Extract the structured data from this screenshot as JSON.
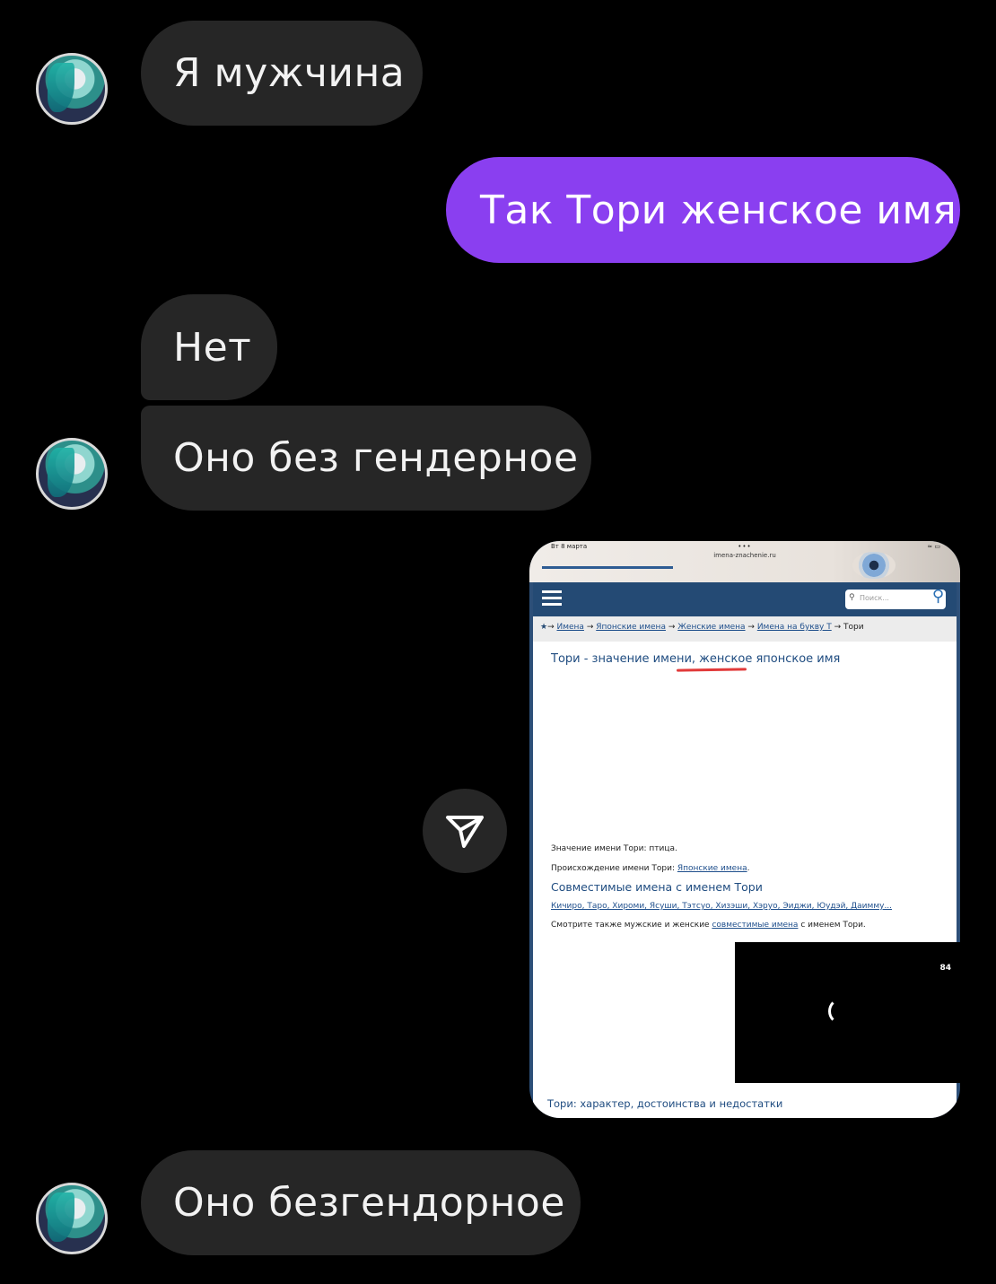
{
  "messages": {
    "m1": "Я мужчина",
    "m2": "Так Тори женское имя",
    "m3": "Нет",
    "m4": "Оно без гендерное",
    "m5": "Оно безгендорное"
  },
  "screenshot": {
    "status_date": "Вт 8 марта",
    "url": "imena-znachenie.ru",
    "search_placeholder": "Поиск...",
    "breadcrumb": {
      "c1": "Имена",
      "c2": "Японские имена",
      "c3": "Женские имена",
      "c4": "Имена на букву Т",
      "c5": "Тори"
    },
    "title": "Тори - значение имени, женское японское имя",
    "meaning_label": "Значение имени Тори: птица.",
    "origin_label": "Происхождение имени Тори: ",
    "origin_link": "Японские имена",
    "compat_heading": "Совместимые имена с именем Тори",
    "compat_names": "Кичиро, Таро, Хироми, Ясуши, Тэтсуо, Хизэши, Хэруо, Эиджи, Юудэй, Даимму...",
    "see_also_pre": "Смотрите также мужские и женские ",
    "see_also_link": "совместимые имена",
    "see_also_post": " с именем Тори.",
    "video_number": "84",
    "bottom_heading": "Тори: характер, достоинства и недостатки"
  },
  "icons": {
    "share": "paper-plane-icon",
    "avatar": "anime-avatar"
  },
  "colors": {
    "background": "#000000",
    "incoming_bubble": "#262626",
    "outgoing_bubble": "#8a3ff0"
  }
}
